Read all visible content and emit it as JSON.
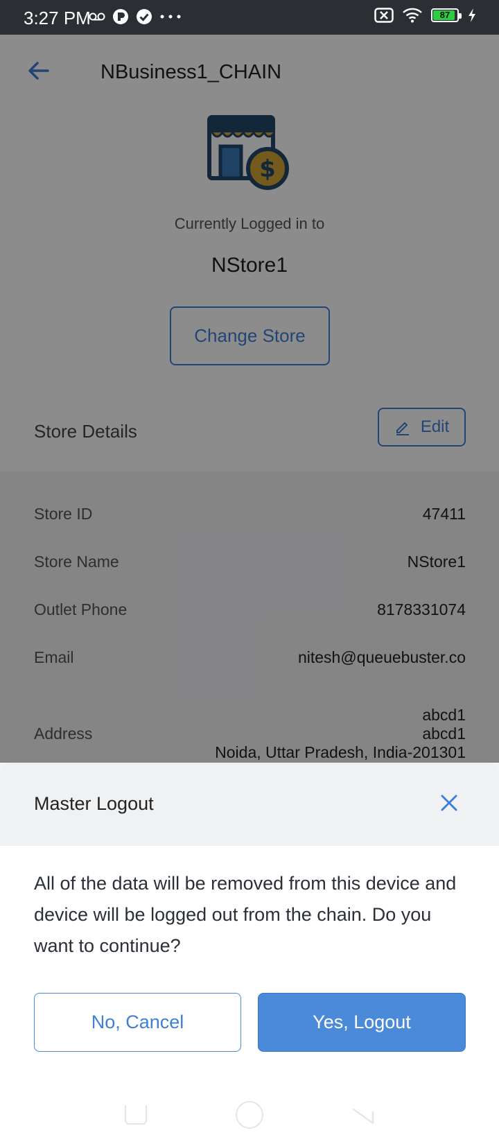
{
  "status_bar": {
    "time": "3:27 PM",
    "battery_level": "87",
    "icons": [
      "voicemail-icon",
      "app-badge-icon",
      "check-circle-icon",
      "more-dots-icon",
      "sim-off-icon",
      "wifi-icon",
      "battery-icon",
      "charging-icon"
    ]
  },
  "header": {
    "title": "NBusiness1_CHAIN",
    "back_icon": "arrow-left-icon"
  },
  "store": {
    "logged_in_label": "Currently Logged in to",
    "current_store": "NStore1",
    "change_store_label": "Change Store"
  },
  "details": {
    "title": "Store Details",
    "edit_label": "Edit",
    "rows": [
      {
        "label": "Store ID",
        "value": "47411"
      },
      {
        "label": "Store Name",
        "value": "NStore1"
      },
      {
        "label": "Outlet Phone",
        "value": "8178331074"
      },
      {
        "label": "Email",
        "value": "nitesh@queuebuster.co"
      }
    ],
    "address": {
      "label": "Address",
      "line1": "abcd1",
      "line2": "abcd1",
      "line3": "Noida, Uttar Pradesh, India-201301"
    }
  },
  "dialog": {
    "title": "Master Logout",
    "message": "All of the data will be removed from this device and device will be logged out from the chain. Do you want to continue?",
    "cancel_label": "No, Cancel",
    "confirm_label": "Yes, Logout"
  },
  "colors": {
    "accent": "#3f7fd6",
    "primary_button": "#4a8ad8",
    "store_icon_dark": "#22476b",
    "store_icon_gold": "#d4a435"
  }
}
